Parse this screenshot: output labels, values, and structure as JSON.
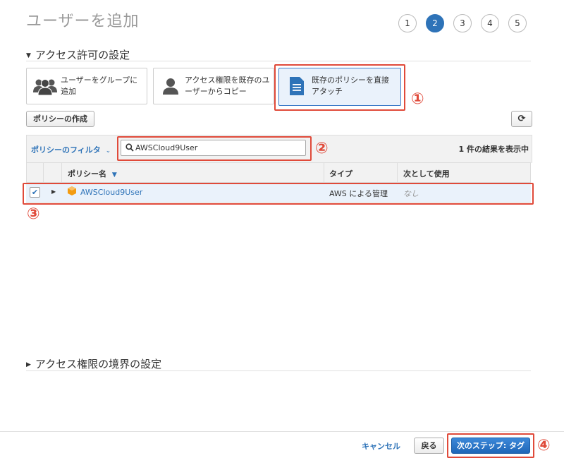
{
  "page": {
    "title": "ユーザーを追加"
  },
  "steps": [
    "1",
    "2",
    "3",
    "4",
    "5"
  ],
  "permissions": {
    "heading": "アクセス許可の設定",
    "options": [
      {
        "label": "ユーザーをグループに追加",
        "icon": "user-group-icon"
      },
      {
        "label": "アクセス権限を既存のユーザーからコピー",
        "icon": "user-icon"
      },
      {
        "label": "既存のポリシーを直接アタッチ",
        "icon": "document-icon"
      }
    ],
    "create_policy_label": "ポリシーの作成"
  },
  "filter": {
    "label": "ポリシーのフィルタ",
    "search_value": "AWSCloud9User",
    "result_count": "1 件の結果を表示中"
  },
  "table": {
    "columns": [
      "ポリシー名",
      "タイプ",
      "次として使用"
    ],
    "rows": [
      {
        "name": "AWSCloud9User",
        "type": "AWS による管理",
        "used_as": "なし",
        "checked": true
      }
    ]
  },
  "boundary": {
    "heading": "アクセス権限の境界の設定"
  },
  "footer": {
    "cancel_label": "キャンセル",
    "back_label": "戻る",
    "next_label": "次のステップ: タグ"
  },
  "annotations": [
    "①",
    "②",
    "③",
    "④"
  ],
  "colors": {
    "accent": "#2e73b8",
    "annotation": "#e04a3a",
    "selected_bg": "#eaf2fb"
  }
}
